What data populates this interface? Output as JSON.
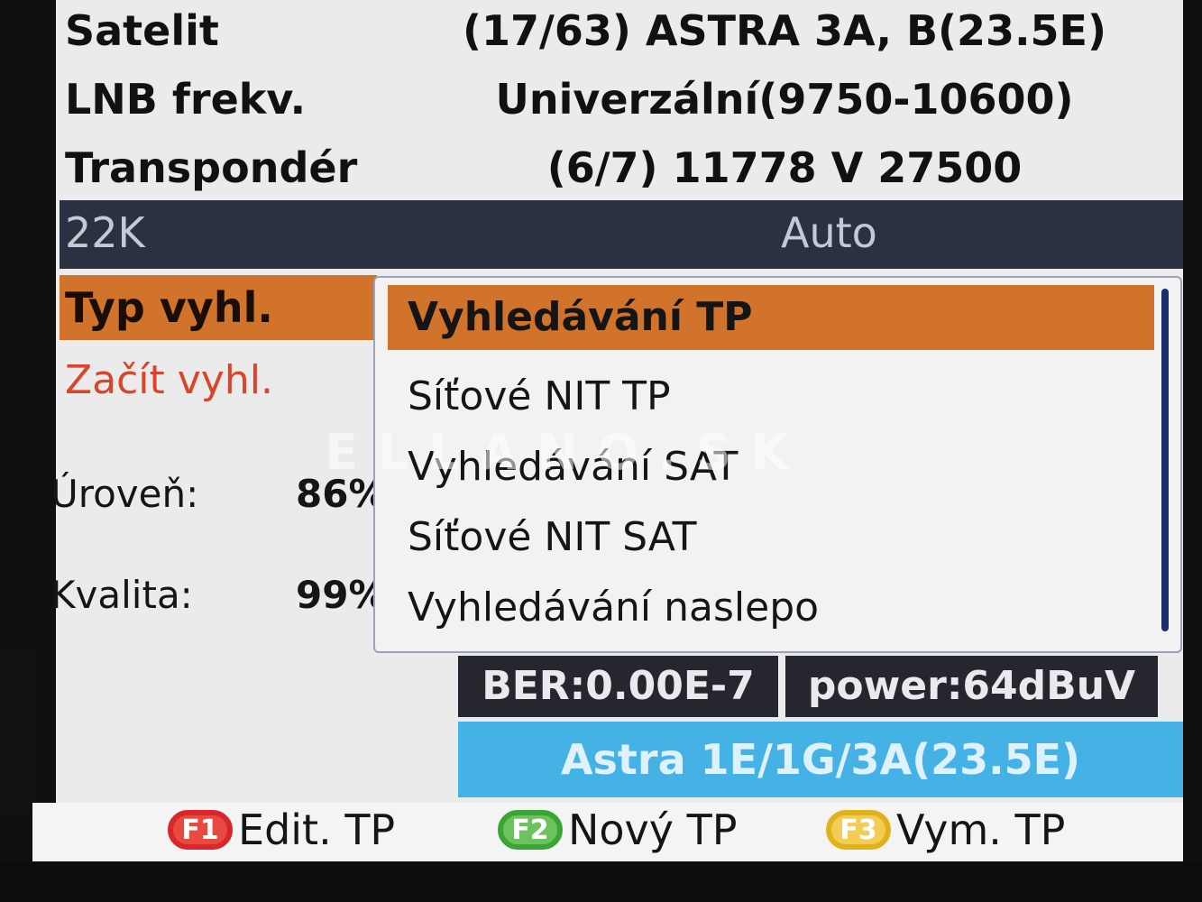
{
  "rows": {
    "satelit": {
      "label": "Satelit",
      "value": "(17/63) ASTRA 3A, B(23.5E)"
    },
    "lnb": {
      "label": "LNB frekv.",
      "value": "Univerzální(9750-10600)"
    },
    "transponder": {
      "label": "Transpondér",
      "value": "(6/7) 11778 V 27500"
    },
    "k22": {
      "label": "22K",
      "value": "Auto"
    },
    "typ": {
      "label": "Typ vyhl."
    },
    "zacit": {
      "label": "Začít vyhl."
    }
  },
  "meters": {
    "uroven": {
      "label": "Úroveň:",
      "value": "86%"
    },
    "kvalita": {
      "label": "Kvalita:",
      "value": "99%"
    }
  },
  "popup": {
    "items": [
      "Vyhledávání TP",
      "Síťové NIT TP",
      "Vyhledávání SAT",
      "Síťové NIT SAT",
      "Vyhledávání naslepo"
    ],
    "selected_index": 0
  },
  "status": {
    "ber": "BER:0.00E-7",
    "power": "power:64dBuV",
    "satellite": "Astra 1E/1G/3A(23.5E)"
  },
  "footer": {
    "red": {
      "key": "F1",
      "label": "Edit. TP",
      "color": "#d9262b"
    },
    "green": {
      "key": "F2",
      "label": "Nový TP",
      "color": "#3aa535"
    },
    "yellow": {
      "key": "F3",
      "label": "Vym. TP",
      "color": "#e0b21c"
    }
  },
  "watermark": "ELLANO.SK",
  "colors": {
    "highlight": "#d2732b",
    "band_dark": "#2a3140",
    "sat_band": "#45b2e6"
  }
}
